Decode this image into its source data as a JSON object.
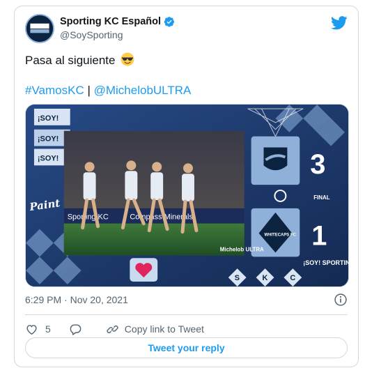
{
  "tweet": {
    "display_name": "Sporting KC Español",
    "handle": "@SoySporting",
    "text": "Pasa al siguiente",
    "emoji": "sunglasses-emoji",
    "hashtag": "#VamosKC",
    "separator": "|",
    "mention": "@MichelobULTRA",
    "timestamp": "6:29 PM · Nov 20, 2021",
    "like_count": "5",
    "copy_link_label": "Copy link to Tweet",
    "reply_label": "Tweet your reply"
  },
  "media": {
    "brand_logo_text": "¡SOY! SPORTING",
    "home_score": "3",
    "away_score": "1",
    "final_label": "FINAL",
    "away_badge_text": "WHITECAPS FC",
    "sponsor_text": "Michelob ULTRA",
    "board_text_1": "Sporting KC",
    "board_text_2": "Compass Minerals",
    "side_text": "Paint the Wall",
    "letters": [
      "S",
      "K",
      "C"
    ]
  },
  "colors": {
    "link": "#1d9bf0",
    "secondary_text": "#536471",
    "border": "#cfd9de",
    "navy": "#0c2340",
    "sporting_blue": "#91b0d5"
  },
  "icons": {
    "verified": "verified-badge-icon",
    "twitter": "twitter-bird-icon",
    "info": "info-icon",
    "like": "heart-icon",
    "reply": "reply-icon",
    "copy_link": "link-icon"
  }
}
